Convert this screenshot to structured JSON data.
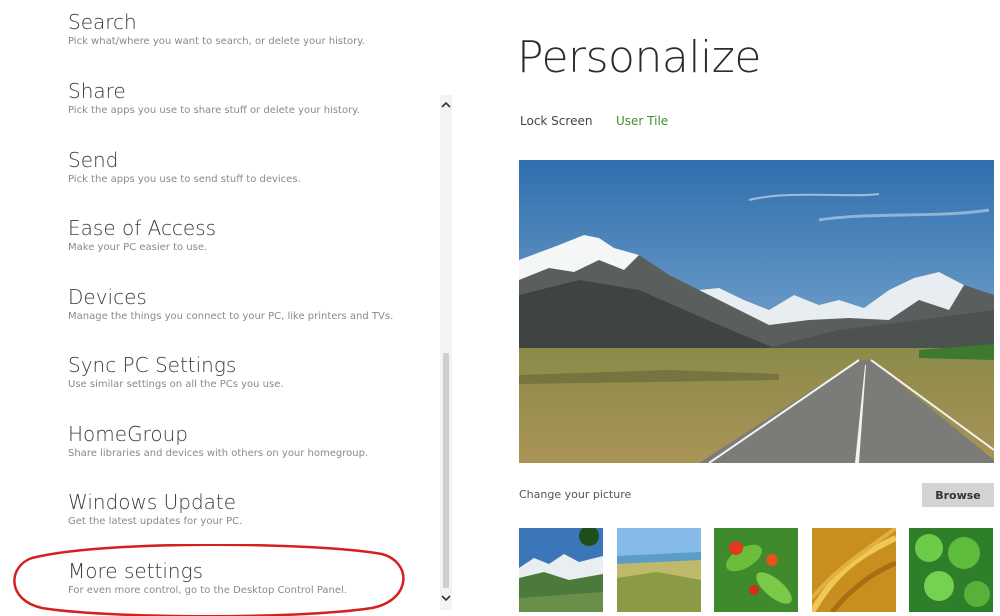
{
  "settings_list": {
    "items": [
      {
        "title": "Search",
        "description": "Pick what/where you want to search, or delete your history."
      },
      {
        "title": "Share",
        "description": "Pick the apps you use to share stuff or delete your history."
      },
      {
        "title": "Send",
        "description": "Pick the apps you use to send stuff to devices."
      },
      {
        "title": "Ease of Access",
        "description": "Make your PC easier to use."
      },
      {
        "title": "Devices",
        "description": "Manage the things you connect to your PC, like printers and TVs."
      },
      {
        "title": "Sync PC Settings",
        "description": "Use similar settings on all the PCs you use."
      },
      {
        "title": "HomeGroup",
        "description": "Share libraries and devices with others on your homegroup."
      },
      {
        "title": "Windows Update",
        "description": "Get the latest updates for your PC."
      },
      {
        "title": "More settings",
        "description": "For even more control, go to the Desktop Control Panel."
      }
    ]
  },
  "scrollbar": {
    "up_icon": "chevron-up-icon",
    "down_icon": "chevron-down-icon"
  },
  "highlight": {
    "color": "#d42020"
  },
  "personalize": {
    "title": "Personalize",
    "tabs": [
      {
        "label": "Lock Screen",
        "selected": false
      },
      {
        "label": "User Tile",
        "selected": true
      }
    ],
    "accent_color": "#3e8e2b",
    "change_picture_label": "Change your picture",
    "browse_label": "Browse",
    "thumbnails": [
      "mountain-valley",
      "grassland",
      "red-flowers",
      "golden-grass",
      "green-clover"
    ]
  }
}
